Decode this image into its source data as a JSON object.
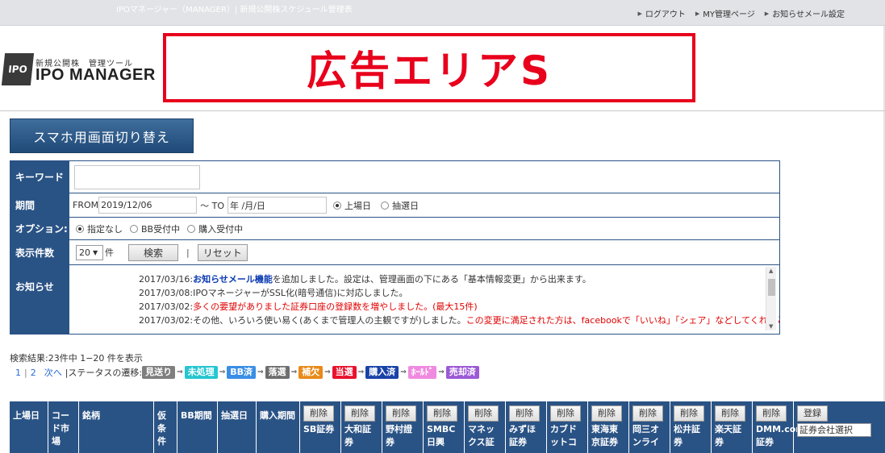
{
  "header": {
    "tagline": "IPOマネージャー（MANAGER）| 新規公開株スケジュール管理表",
    "nav": [
      "ログアウト",
      "MY管理ページ",
      "お知らせメール設定"
    ]
  },
  "logo": {
    "mark": "IPO",
    "subtitle": "新規公開株　管理ツール",
    "title": "IPO MANAGER"
  },
  "ad": {
    "text": "広告エリアS",
    "color": "#e8001c"
  },
  "mobile_switch_label": "スマホ用画面切り替え",
  "form": {
    "keyword_label": "キーワード",
    "keyword_value": "",
    "period_label": "期間",
    "from_label": "FROM",
    "from_value": "2019/12/06",
    "to_sep": "～ TO",
    "to_value": "年 /月/日",
    "period_options": [
      "上場日",
      "抽選日"
    ],
    "period_selected": "上場日",
    "option_label": "オプション:",
    "option_choices": [
      "指定なし",
      "BB受付中",
      "購入受付中"
    ],
    "option_selected": "指定なし",
    "count_label": "表示件数",
    "count_value": "20",
    "count_unit": "件",
    "search_label": "検索",
    "pipe": "|",
    "reset_label": "リセット",
    "notice_label": "お知らせ"
  },
  "notices": [
    {
      "prefix": "2017/03/16:",
      "link": "お知らせメール機能",
      "rest": "を追加しました。設定は、管理画面の下にある「基本情報変更」から出来ます。"
    },
    {
      "text": "2017/03/08:IPOマネージャーがSSL化(暗号通信)に対応しました。"
    },
    {
      "prefix": "2017/03/02:",
      "red": "多くの要望がありました証券口座の登録数を増やしました。(最大15件)"
    },
    {
      "prefix": "2017/03/02:その他、いろいろ使い易く(あくまで管理人の主観ですが)しました。",
      "red": "この変更に満足された方は、facebookで「いいね」「シェア」などしてくれると嬉しいで"
    }
  ],
  "results": {
    "summary": "検索結果:23件中 1−20 件を表示",
    "pages": [
      "1",
      "2"
    ],
    "next_label": "次へ",
    "status_flow_label": "|ステータスの遷移:",
    "statuses": [
      {
        "label": "見送り",
        "color": "#7f7f7f"
      },
      {
        "label": "未処理",
        "color": "#26c6d0"
      },
      {
        "label": "BB済",
        "color": "#3a8ee6"
      },
      {
        "label": "落選",
        "color": "#6e6e6e"
      },
      {
        "label": "補欠",
        "color": "#e98a19"
      },
      {
        "label": "当選",
        "color": "#e8112d"
      },
      {
        "label": "購入済",
        "color": "#1a43a8"
      },
      {
        "label": "ﾎｰﾙﾄﾞ",
        "color": "#f08ae0"
      },
      {
        "label": "売却済",
        "color": "#9b59d6"
      }
    ]
  },
  "table": {
    "columns": {
      "listing_date": "上場日",
      "code": "コード市場",
      "name": "銘柄",
      "provisional": "仮条件",
      "bb_period": "BB期間",
      "lottery_date": "抽選日",
      "purchase_period": "購入期間"
    },
    "delete_label": "削除",
    "brokers": [
      "SB証券",
      "大和証券",
      "野村證券",
      "SMBC日興",
      "マネックス証",
      "みずほ証券",
      "カブドットコ",
      "東海東京証券",
      "岡三オンライ",
      "松井証券",
      "楽天証券",
      "DMM.com証券"
    ],
    "register_label": "登録",
    "broker_select": "証券会社選択"
  }
}
